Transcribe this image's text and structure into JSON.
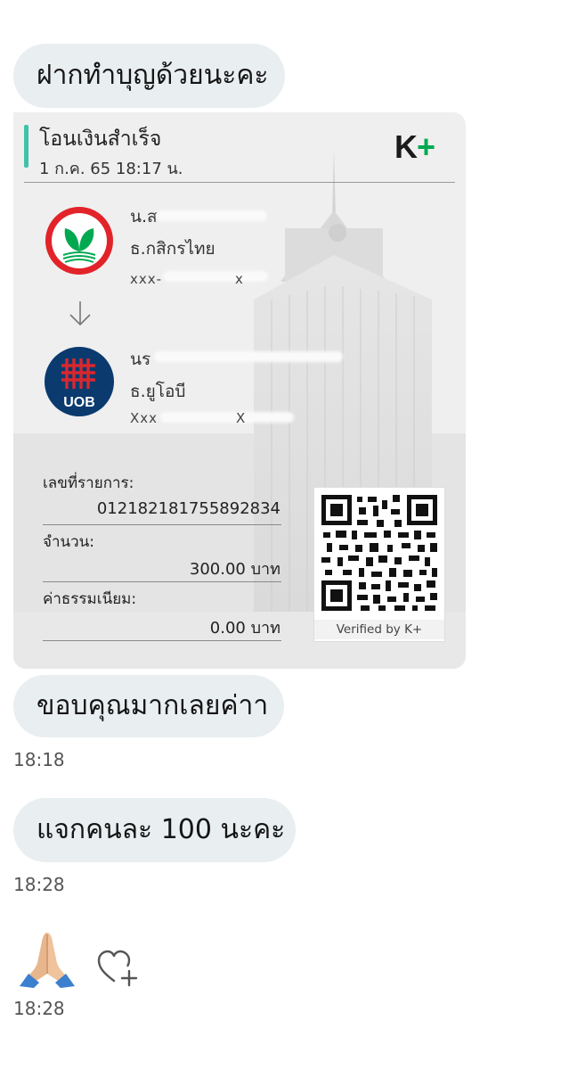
{
  "messages": {
    "m1": "ฝากทำบุญด้วยนะคะ",
    "m2": "ขอบคุณมากเลยค่าา",
    "m3": "แจกคนละ  100 นะคะ",
    "time1": "18:18",
    "time2": "18:28",
    "time3": "18:28"
  },
  "slip": {
    "title": "โอนเงินสำเร็จ",
    "date": "1 ก.ค. 65  18:17 น.",
    "brand": "K",
    "brand_plus": "+",
    "sender": {
      "name_partial": "น.ส",
      "bank": "ธ.กสิกรไทย",
      "account_partial": "xxx-",
      "account_tail": "x",
      "logo": "kasikorn-logo"
    },
    "receiver": {
      "name_partial": "นร",
      "bank": "ธ.ยูโอบี",
      "account_partial": "Xxx",
      "account_tail": "X",
      "logo": "uob-logo",
      "logo_text": "UOB"
    },
    "ref_label": "เลขที่รายการ:",
    "ref_value": "012182181755892834",
    "amount_label": "จำนวน:",
    "amount_value": "300.00 บาท",
    "fee_label": "ค่าธรรมเนียม:",
    "fee_value": "0.00 บาท",
    "verified": "Verified by K+"
  },
  "reaction": {
    "emoji": "🙏",
    "add_reaction_icon": "heart-plus-icon"
  },
  "colors": {
    "bubble": "#e9eef0",
    "accent": "#3fc2a8",
    "kbank_green": "#00a950",
    "uob_navy": "#0a3a6e",
    "uob_red": "#d7282f"
  }
}
